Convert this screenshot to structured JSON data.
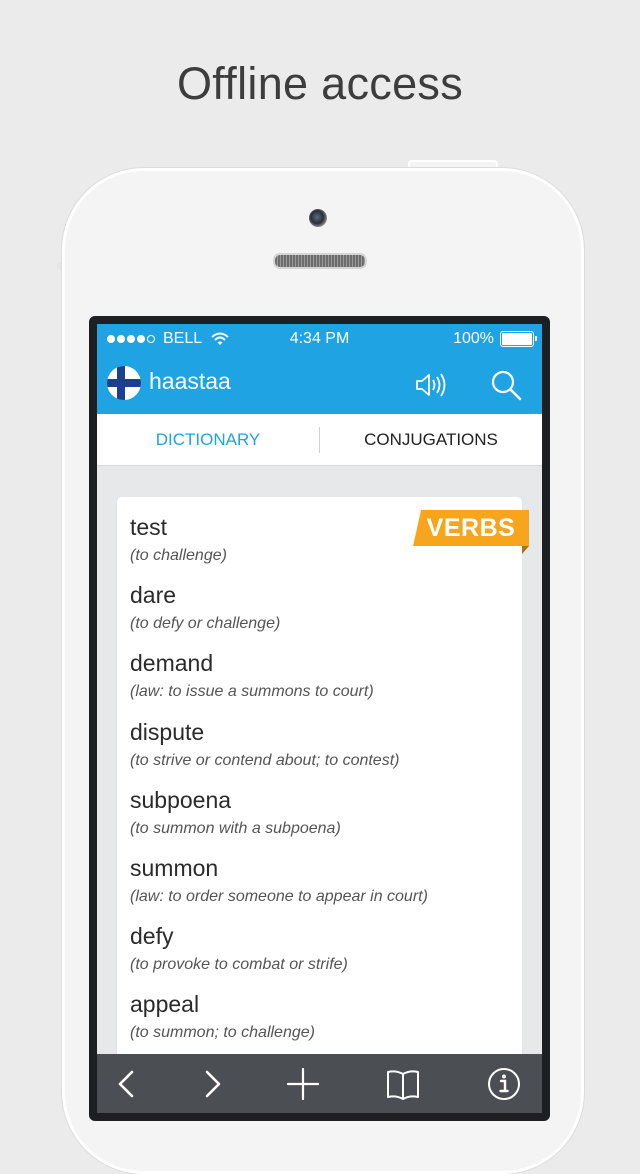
{
  "headline": "Offline access",
  "status_bar": {
    "carrier": "BELL",
    "time": "4:34 PM",
    "battery": "100%",
    "signal_bars": 4
  },
  "header": {
    "search_term": "haastaa",
    "flag_icon": "finland-flag-icon",
    "speaker_icon": "speaker-icon",
    "search_icon": "search-icon"
  },
  "tabs": [
    {
      "label": "DICTIONARY",
      "active": true
    },
    {
      "label": "CONJUGATIONS",
      "active": false
    }
  ],
  "badge": "VERBS",
  "entries": [
    {
      "word": "test",
      "definition": "(to challenge)"
    },
    {
      "word": "dare",
      "definition": "(to defy or challenge)"
    },
    {
      "word": "demand",
      "definition": "(law: to issue a summons to court)"
    },
    {
      "word": "dispute",
      "definition": "(to strive or contend about; to contest)"
    },
    {
      "word": "subpoena",
      "definition": "(to summon with a subpoena)"
    },
    {
      "word": "summon",
      "definition": "(law: to order someone to appear in court)"
    },
    {
      "word": "defy",
      "definition": "(to provoke to combat or strife)"
    },
    {
      "word": "appeal",
      "definition": "(to summon; to challenge)"
    }
  ],
  "toolbar": [
    "back-icon",
    "forward-icon",
    "add-icon",
    "bookmarks-icon",
    "info-icon"
  ],
  "colors": {
    "accent": "#1fa3e3",
    "badge": "#f7a51c",
    "toolbar": "#4b4e53"
  }
}
